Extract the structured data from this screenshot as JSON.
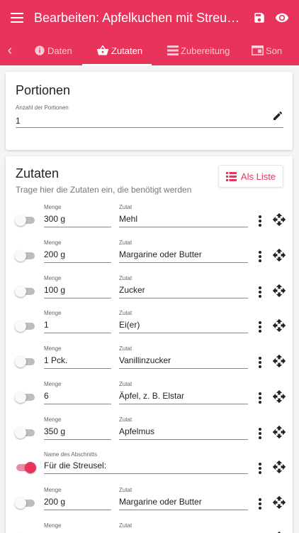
{
  "app_bar": {
    "title": "Bearbeiten: Apfelkuchen mit Streuseln ...",
    "menu_icon": "menu-icon",
    "save_icon": "save-icon",
    "preview_icon": "eye-icon",
    "color": "#e8345a"
  },
  "tabs": {
    "items": [
      {
        "label": "Daten",
        "icon": "info-icon"
      },
      {
        "label": "Zutaten",
        "icon": "basket-icon"
      },
      {
        "label": "Zubereitung",
        "icon": "list-icon"
      },
      {
        "label": "Son",
        "icon": "card-icon"
      }
    ],
    "active": "Zutaten"
  },
  "portionen": {
    "title": "Portionen",
    "field_label": "Anzahl der Portionen",
    "value": "1"
  },
  "zutaten": {
    "title": "Zutaten",
    "subtitle": "Trage hier die Zutaten ein, die benötigt werden",
    "liste_button": "Als Liste",
    "rows": [
      {
        "type": "ingredient",
        "menge_label": "Menge",
        "zutat_label": "Zutat",
        "menge": "300 g",
        "zutat": "Mehl",
        "toggle_on": false
      },
      {
        "type": "ingredient",
        "menge_label": "Menge",
        "zutat_label": "Zutat",
        "menge": "200 g",
        "zutat": "Margarine oder Butter",
        "toggle_on": false
      },
      {
        "type": "ingredient",
        "menge_label": "Menge",
        "zutat_label": "Zutat",
        "menge": "100 g",
        "zutat": "Zucker",
        "toggle_on": false
      },
      {
        "type": "ingredient",
        "menge_label": "Menge",
        "zutat_label": "Zutat",
        "menge": "1",
        "zutat": "Ei(er)",
        "toggle_on": false
      },
      {
        "type": "ingredient",
        "menge_label": "Menge",
        "zutat_label": "Zutat",
        "menge": "1 Pck.",
        "zutat": "Vanillinzucker",
        "toggle_on": false
      },
      {
        "type": "ingredient",
        "menge_label": "Menge",
        "zutat_label": "Zutat",
        "menge": "6",
        "zutat": "Äpfel, z. B. Elstar",
        "toggle_on": false
      },
      {
        "type": "ingredient",
        "menge_label": "Menge",
        "zutat_label": "Zutat",
        "menge": "350 g",
        "zutat": "Apfelmus",
        "toggle_on": false
      },
      {
        "type": "section",
        "section_label": "Name des Abschnitts",
        "name": "Für die Streusel:",
        "toggle_on": true
      },
      {
        "type": "ingredient",
        "menge_label": "Menge",
        "zutat_label": "Zutat",
        "menge": "200 g",
        "zutat": "Margarine oder Butter",
        "toggle_on": false
      },
      {
        "type": "ingredient",
        "menge_label": "Menge",
        "zutat_label": "Zutat",
        "menge": "",
        "zutat": "",
        "toggle_on": false
      }
    ]
  }
}
